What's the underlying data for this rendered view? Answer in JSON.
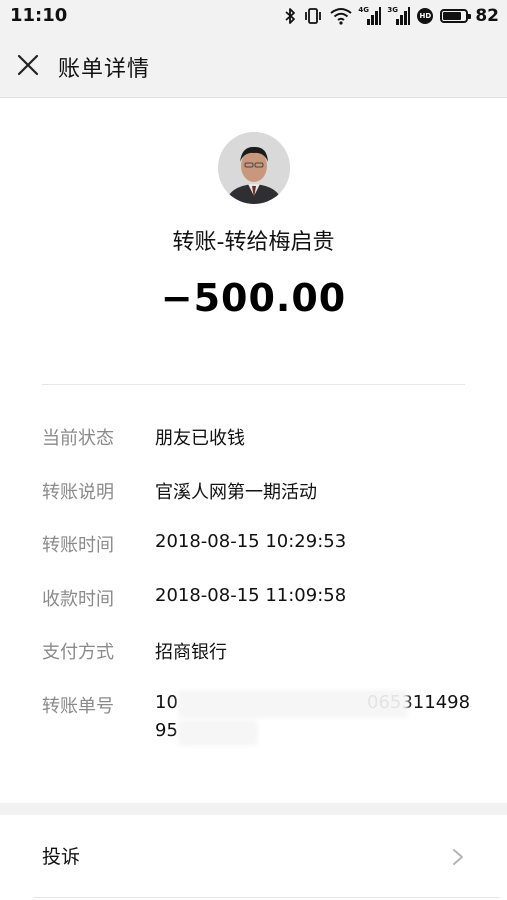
{
  "status_bar": {
    "time": "11:10",
    "network_1": "4G",
    "network_2": "3G",
    "hd_badge": "HD",
    "battery_percent": "82",
    "battery_level": 0.82
  },
  "header": {
    "title": "账单详情"
  },
  "hero": {
    "transfer_title": "转账-转给梅启贵",
    "amount": "−500.00"
  },
  "details": [
    {
      "label": "当前状态",
      "value": "朋友已收钱"
    },
    {
      "label": "转账说明",
      "value": "官溪人网第一期活动"
    },
    {
      "label": "转账时间",
      "value": "2018-08-15 10:29:53"
    },
    {
      "label": "收款时间",
      "value": "2018-08-15 11:09:58"
    },
    {
      "label": "支付方式",
      "value": "招商银行"
    },
    {
      "label": "转账单号",
      "value_line1_start": "10",
      "value_line1_end": "065311498",
      "value_line2_start": "95"
    }
  ],
  "footer": {
    "complaint_label": "投诉"
  }
}
